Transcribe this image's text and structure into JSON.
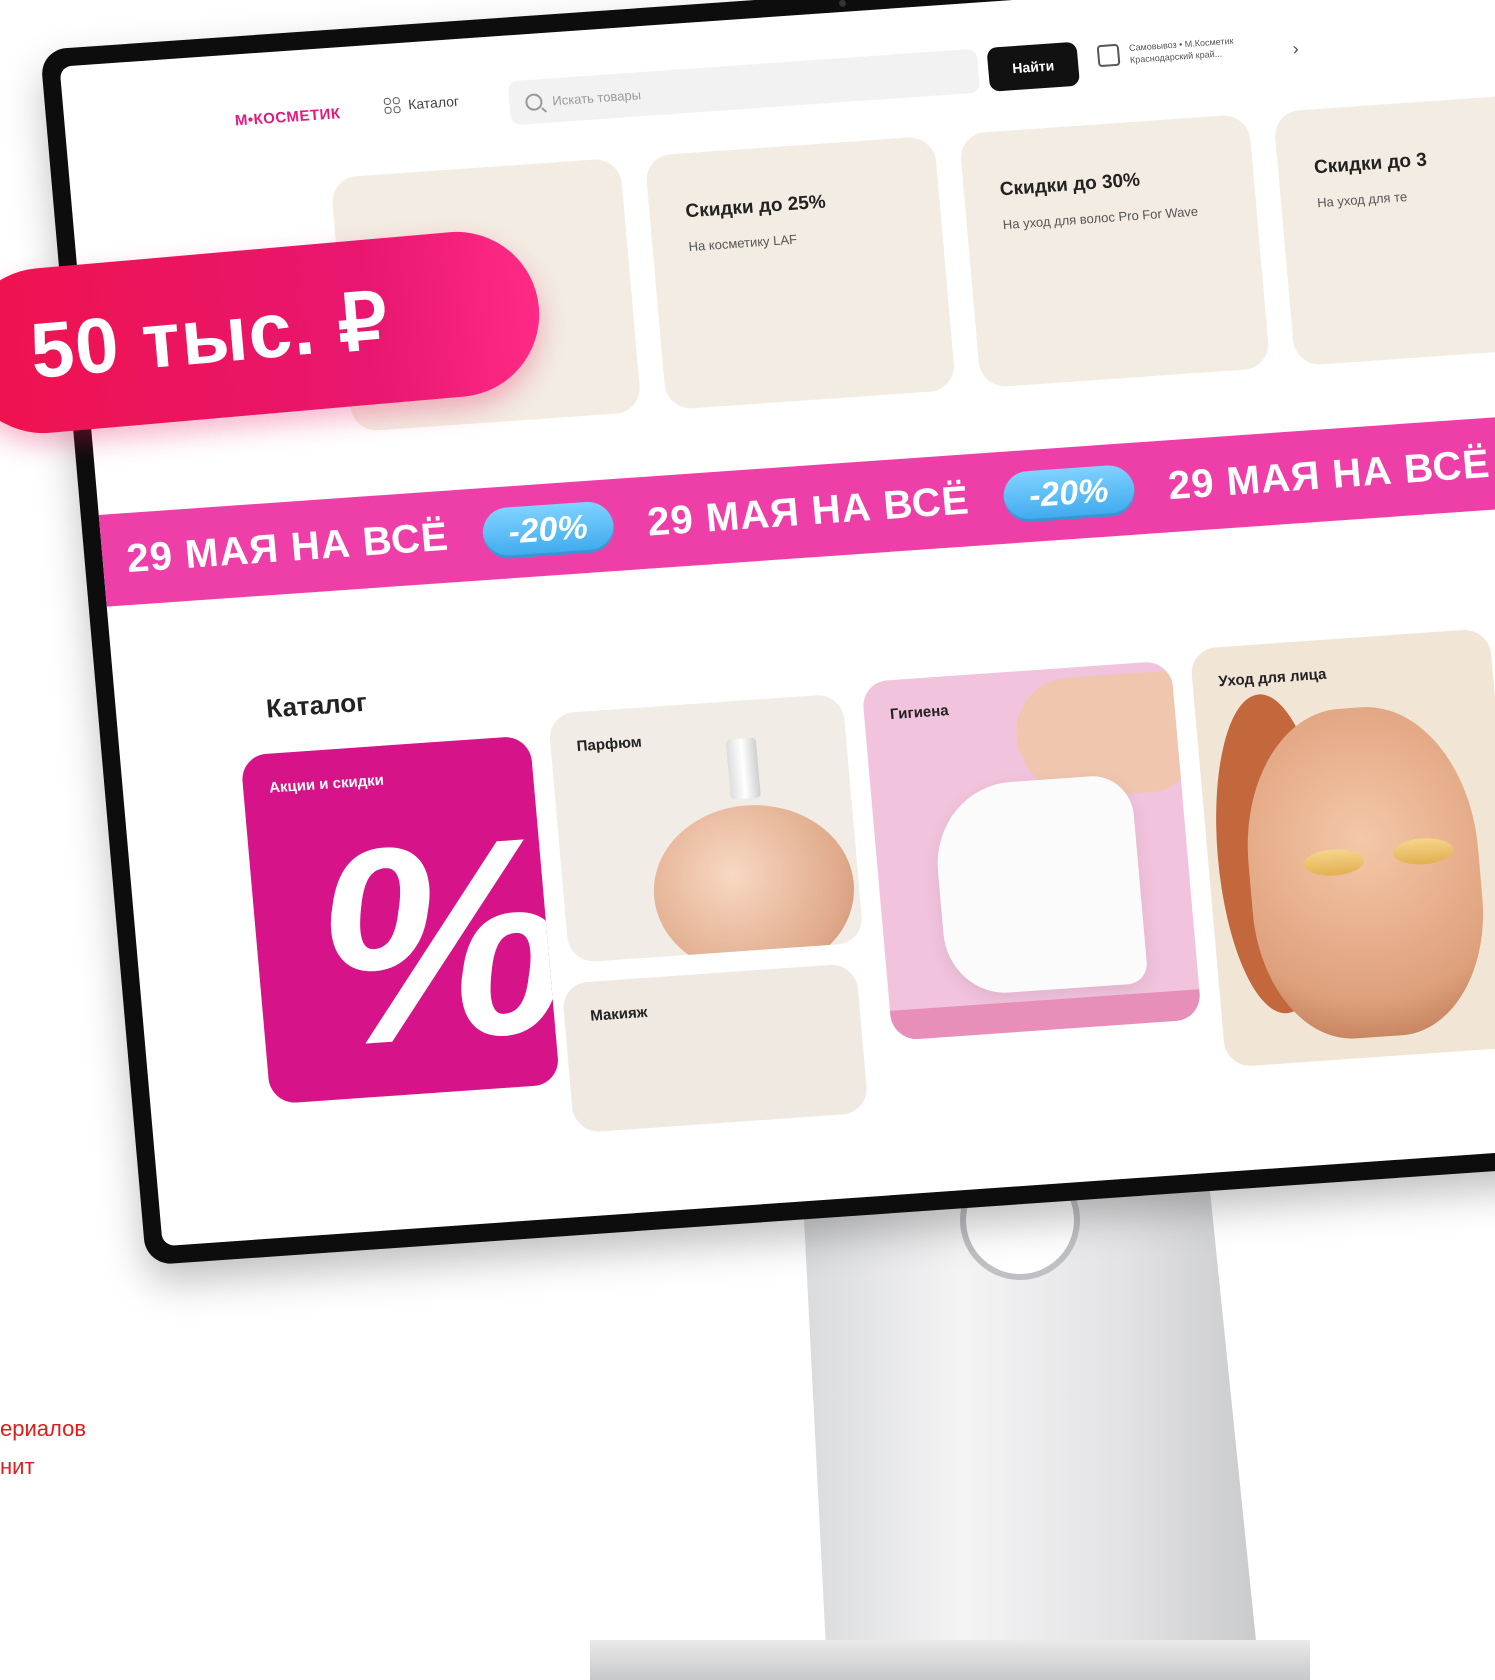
{
  "header": {
    "logo": "М•КОСМЕТИК",
    "catalog_label": "Каталог",
    "search_placeholder": "Искать товары",
    "find_label": "Найти",
    "pickup_line1": "Самовывоз • М.Косметик",
    "pickup_line2": "Краснодарский край..."
  },
  "promos": [
    {
      "title": "Скидки до 25%",
      "subtitle": "На косметику LAF"
    },
    {
      "title": "Скидки до 30%",
      "subtitle": "На уход для волос Pro For Wave"
    },
    {
      "title": "Скидки до 3",
      "subtitle": "На уход для те"
    }
  ],
  "marquee": {
    "text": "29 МАЯ НА ВСЁ",
    "badge": "-20%"
  },
  "catalog": {
    "title": "Каталог",
    "tiles": [
      "Акции и скидки",
      "Парфюм",
      "Макияж",
      "Гигиена",
      "Уход для лица"
    ]
  },
  "overlay": {
    "price": "50 тыс. ₽",
    "note_line1": "ериалов",
    "note_line2": "нит"
  },
  "colors": {
    "brand_pink": "#e6197d",
    "marquee_pink": "#ee3fa9",
    "badge_blue": "#3ea9ee"
  }
}
